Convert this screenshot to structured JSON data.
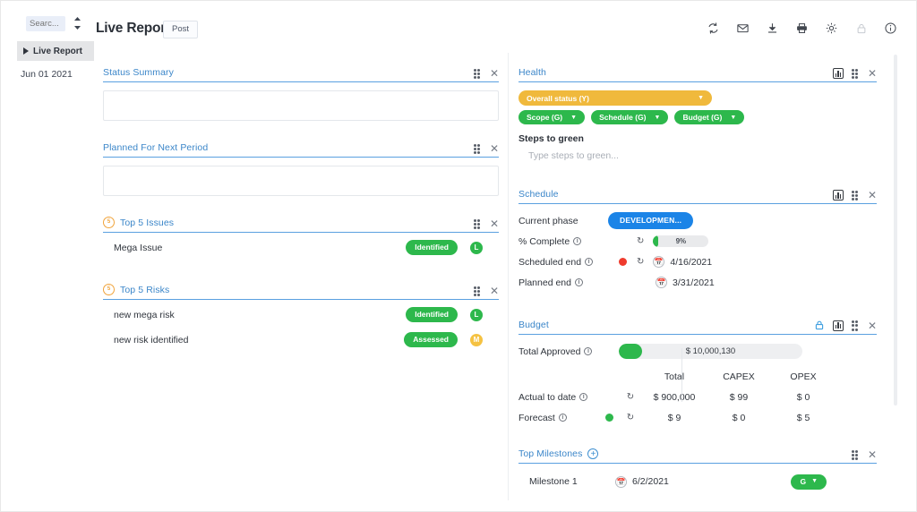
{
  "topbar": {
    "search_placeholder": "Searc...",
    "sort_icon": "sort-toggle-icon",
    "title": "Live Report",
    "post_label": "Post",
    "icons": [
      {
        "name": "refresh-icon",
        "glyph": "↻",
        "muted": false
      },
      {
        "name": "mail-icon",
        "glyph": "✉",
        "muted": false
      },
      {
        "name": "download-icon",
        "glyph": "⤓",
        "muted": false
      },
      {
        "name": "print-icon",
        "glyph": "⎙",
        "muted": false
      },
      {
        "name": "gear-icon",
        "glyph": "⚙",
        "muted": false
      },
      {
        "name": "lock-icon",
        "glyph": "ὑ2",
        "muted": true
      },
      {
        "name": "info-icon",
        "glyph": "ⓘ",
        "muted": false
      }
    ]
  },
  "sidebar": {
    "tab_label": "Live Report",
    "date": "Jun 01 2021"
  },
  "left_panels": {
    "status_summary": {
      "title": "Status Summary",
      "value": ""
    },
    "planned_next": {
      "title": "Planned For Next Period",
      "value": ""
    },
    "top_issues": {
      "title": "Top 5 Issues",
      "rows": [
        {
          "name": "Mega Issue",
          "status": "Identified",
          "severity": "L",
          "severity_color": "green"
        }
      ]
    },
    "top_risks": {
      "title": "Top 5 Risks",
      "rows": [
        {
          "name": "new mega risk",
          "status": "Identified",
          "severity": "L",
          "severity_color": "green"
        },
        {
          "name": "new risk identified",
          "status": "Assessed",
          "severity": "M",
          "severity_color": "yellow"
        }
      ]
    }
  },
  "right_panels": {
    "health": {
      "title": "Health",
      "overall_status": "Overall status (Y)",
      "sub_status": [
        "Scope (G)",
        "Schedule (G)",
        "Budget (G)"
      ],
      "steps_label": "Steps to green",
      "steps_placeholder": "Type steps to green..."
    },
    "schedule": {
      "title": "Schedule",
      "current_phase_label": "Current phase",
      "current_phase_value": "DEVELOPMEN...",
      "percent_complete_label": "% Complete",
      "percent_complete_value": "9%",
      "percent_complete_num": 9,
      "scheduled_end_label": "Scheduled end",
      "scheduled_end_value": "4/16/2021",
      "scheduled_end_status": "red",
      "planned_end_label": "Planned end",
      "planned_end_value": "3/31/2021"
    },
    "budget": {
      "title": "Budget",
      "total_approved_label": "Total Approved",
      "total_approved_value": "$ 10,000,130",
      "columns": [
        "Total",
        "CAPEX",
        "OPEX"
      ],
      "rows": [
        {
          "label": "Actual to date",
          "status": "",
          "total": "$ 900,000",
          "capex": "$ 99",
          "opex": "$ 0"
        },
        {
          "label": "Forecast",
          "status": "green",
          "total": "$ 9",
          "capex": "$ 0",
          "opex": "$ 5"
        }
      ]
    },
    "milestones": {
      "title": "Top Milestones",
      "rows": [
        {
          "name": "Milestone 1",
          "date": "6/2/2021",
          "status": "G"
        }
      ]
    }
  },
  "colors": {
    "accent_blue": "#3b86c9",
    "green": "#2db84c",
    "amber": "#f0b93c",
    "red": "#ef3b2d",
    "phase_blue": "#1b84e7"
  }
}
